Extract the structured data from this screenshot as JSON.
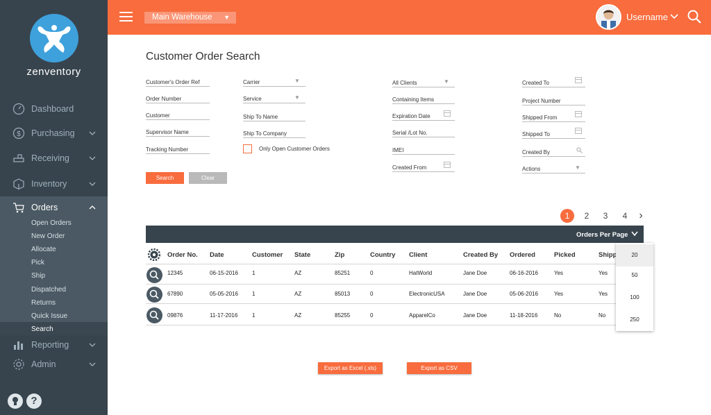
{
  "brand": {
    "logo_text": "zenventory"
  },
  "sidebar": {
    "items": [
      {
        "label": "Dashboard"
      },
      {
        "label": "Purchasing"
      },
      {
        "label": "Receiving"
      },
      {
        "label": "Inventory"
      },
      {
        "label": "Orders"
      },
      {
        "label": "Reporting"
      },
      {
        "label": "Admin"
      }
    ],
    "orders_sub": [
      "Open Orders",
      "New Order",
      "Allocate",
      "Pick",
      "Ship",
      "Dispatched",
      "Returns",
      "Quick Issue",
      "Search"
    ]
  },
  "topbar": {
    "warehouse": "Main Warehouse",
    "username": "Username"
  },
  "page": {
    "title": "Customer Order Search"
  },
  "form": {
    "col1": [
      "Customer's Order Ref",
      "Order Number",
      "Customer",
      "Supervisor Name",
      "Tracking Number"
    ],
    "col2": [
      "Carrier",
      "Service",
      "Ship To Name",
      "Ship To Company"
    ],
    "checkbox_label": "Only Open Customer Orders",
    "col3": [
      "All Clients",
      "Containing Items",
      "Expiration Date",
      "Serial /Lot No.",
      "IMEI",
      "Created From"
    ],
    "col4": [
      "Created To",
      "Project Number",
      "Shipped From",
      "Shipped To",
      "Created By",
      "Actions"
    ],
    "search_label": "Search",
    "clear_label": "Clear"
  },
  "pagination": {
    "pages": [
      "1",
      "2",
      "3",
      "4"
    ],
    "next": "›",
    "current": "1"
  },
  "table": {
    "orders_per_page_label": "Orders Per Page",
    "headers": [
      "Order No.",
      "Date",
      "Customer",
      "State",
      "Zip",
      "Country",
      "Client",
      "Created By",
      "Ordered",
      "Picked",
      "Shipp"
    ],
    "rows": [
      [
        "12345",
        "06-15-2016",
        "1",
        "AZ",
        "85251",
        "0",
        "HatWorld",
        "Jane Doe",
        "06-16-2016",
        "Yes",
        "Yes"
      ],
      [
        "67890",
        "05-05-2016",
        "1",
        "AZ",
        "85013",
        "0",
        "ElectronicUSA",
        "Jane Doe",
        "05-06-2016",
        "Yes",
        "Yes"
      ],
      [
        "09876",
        "11-17-2016",
        "1",
        "AZ",
        "85255",
        "0",
        "ApparelCo",
        "Jane Doe",
        "11-18-2016",
        "No",
        "No"
      ]
    ],
    "per_page_options": [
      "20",
      "50",
      "100",
      "250"
    ],
    "per_page_selected": "20"
  },
  "export": {
    "excel_label": "Export as Excel (.xls)",
    "csv_label": "Export as CSV"
  },
  "colors": {
    "accent": "#f86c3d",
    "sidebar": "#37444d",
    "logo": "#3ea1dc"
  }
}
